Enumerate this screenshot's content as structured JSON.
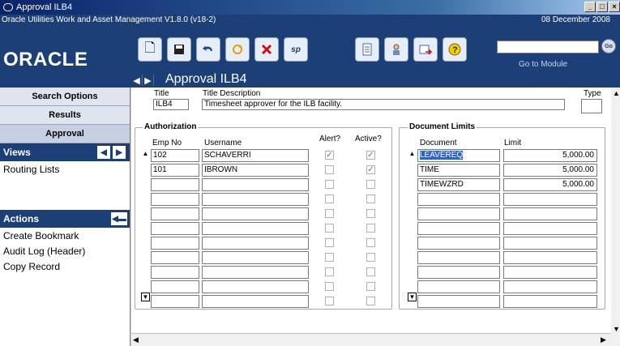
{
  "window": {
    "title": "Approval ILB4"
  },
  "app": {
    "name": "Oracle Utilities Work and Asset Management V1.8.0 (v18-2)",
    "date": "08 December  2008"
  },
  "logo": "ORACLE",
  "toolbar": {
    "go_label": "Go",
    "goto_module": "Go to Module",
    "buttons": [
      "new-icon",
      "save-icon",
      "undo-icon",
      "refresh-icon",
      "delete-icon",
      "spell-check-icon",
      "document-icon",
      "person-icon",
      "routing-icon",
      "help-icon"
    ]
  },
  "page_title": "Approval ILB4",
  "nav": {
    "buttons": [
      "Search Options",
      "Results",
      "Approval"
    ],
    "views_title": "Views",
    "views_items": [
      "Routing Lists"
    ],
    "actions_title": "Actions",
    "actions_items": [
      "Create Bookmark",
      "Audit Log (Header)",
      "Copy Record"
    ]
  },
  "form": {
    "title_label": "Title",
    "title_value": "ILB4",
    "desc_label": "Title Description",
    "desc_value": "Timesheet approver for the ILB facility.",
    "type_label": "Type",
    "type_value": ""
  },
  "authorization": {
    "title": "Authorization",
    "headers": {
      "emp": "Emp No",
      "user": "Username",
      "alert": "Alert?",
      "active": "Active?"
    },
    "rows": [
      {
        "emp": "102",
        "user": "SCHAVERRI",
        "alert": true,
        "active": true
      },
      {
        "emp": "101",
        "user": "IBROWN",
        "alert": false,
        "active": true
      },
      {
        "emp": "",
        "user": "",
        "alert": false,
        "active": false
      },
      {
        "emp": "",
        "user": "",
        "alert": false,
        "active": false
      },
      {
        "emp": "",
        "user": "",
        "alert": false,
        "active": false
      },
      {
        "emp": "",
        "user": "",
        "alert": false,
        "active": false
      },
      {
        "emp": "",
        "user": "",
        "alert": false,
        "active": false
      },
      {
        "emp": "",
        "user": "",
        "alert": false,
        "active": false
      },
      {
        "emp": "",
        "user": "",
        "alert": false,
        "active": false
      },
      {
        "emp": "",
        "user": "",
        "alert": false,
        "active": false
      },
      {
        "emp": "",
        "user": "",
        "alert": false,
        "active": false
      }
    ]
  },
  "document_limits": {
    "title": "Document Limits",
    "headers": {
      "doc": "Document",
      "limit": "Limit"
    },
    "rows": [
      {
        "doc": "LEAVEREQ",
        "limit": "5,000.00"
      },
      {
        "doc": "TIME",
        "limit": "5,000.00"
      },
      {
        "doc": "TIMEWZRD",
        "limit": "5,000.00"
      },
      {
        "doc": "",
        "limit": ""
      },
      {
        "doc": "",
        "limit": ""
      },
      {
        "doc": "",
        "limit": ""
      },
      {
        "doc": "",
        "limit": ""
      },
      {
        "doc": "",
        "limit": ""
      },
      {
        "doc": "",
        "limit": ""
      },
      {
        "doc": "",
        "limit": ""
      },
      {
        "doc": "",
        "limit": ""
      }
    ]
  }
}
